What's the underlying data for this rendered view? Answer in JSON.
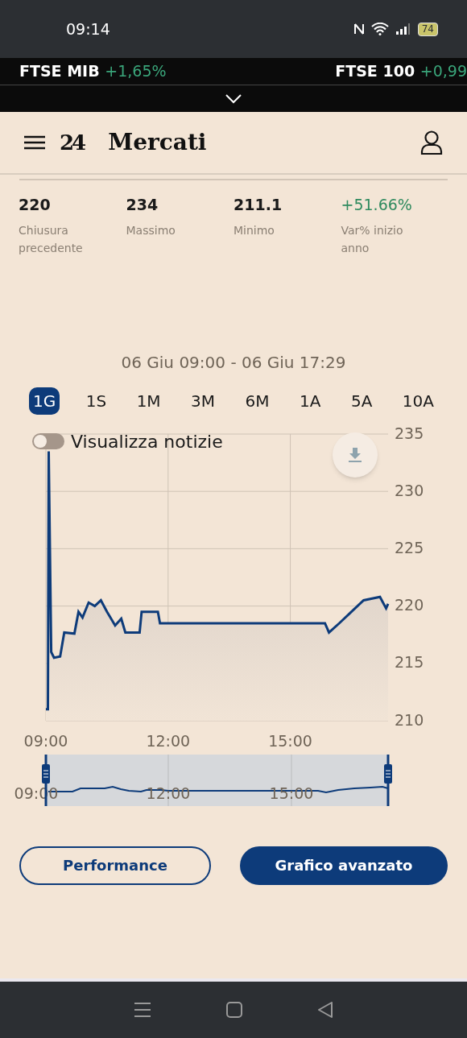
{
  "status_bar": {
    "time": "09:14",
    "battery": "74"
  },
  "ticker": [
    {
      "name": "FTSE MIB",
      "change": "+1,65%"
    },
    {
      "name": "FTSE 100",
      "change": "+0,99"
    }
  ],
  "header": {
    "logo": "24",
    "title": "Mercati"
  },
  "stats": [
    {
      "value": "220",
      "label": "Chiusura precedente",
      "positive": false
    },
    {
      "value": "234",
      "label": "Massimo",
      "positive": false
    },
    {
      "value": "211.1",
      "label": "Minimo",
      "positive": false
    },
    {
      "value": "+51.66%",
      "label": "Var% inizio anno",
      "positive": true
    }
  ],
  "date_range": "06 Giu 09:00 - 06 Giu 17:29",
  "periods": [
    {
      "label": "1G",
      "selected": true
    },
    {
      "label": "1S",
      "selected": false
    },
    {
      "label": "1M",
      "selected": false
    },
    {
      "label": "3M",
      "selected": false
    },
    {
      "label": "6M",
      "selected": false
    },
    {
      "label": "1A",
      "selected": false
    },
    {
      "label": "5A",
      "selected": false
    },
    {
      "label": "10A",
      "selected": false
    }
  ],
  "news_toggle": {
    "label": "Visualizza notizie",
    "on": false
  },
  "chart": {
    "chart_data": {
      "type": "area",
      "x": [
        9.0,
        9.05,
        9.07,
        9.13,
        9.2,
        9.35,
        9.45,
        9.7,
        9.8,
        9.9,
        10.05,
        10.2,
        10.35,
        10.5,
        10.7,
        10.85,
        10.95,
        11.3,
        11.35,
        11.75,
        11.8,
        15.85,
        15.95,
        16.2,
        16.5,
        16.8,
        17.2,
        17.35,
        17.4
      ],
      "grid": true,
      "series": [
        {
          "color": "#0d3b7a",
          "values": [
            211,
            211,
            233.5,
            216,
            215.5,
            215.6,
            217.7,
            217.6,
            219.5,
            219,
            220.3,
            220,
            220.5,
            219.5,
            218.3,
            218.9,
            217.7,
            217.7,
            219.5,
            219.5,
            218.5,
            218.5,
            217.7,
            218.5,
            219.5,
            220.5,
            220.8,
            219.8,
            220.2
          ]
        }
      ],
      "xlim": [
        9,
        17.4
      ],
      "ylim": [
        210,
        235
      ],
      "xticks": [
        {
          "value": 9,
          "label": "09:00"
        },
        {
          "value": 12,
          "label": "12:00"
        },
        {
          "value": 15,
          "label": "15:00"
        }
      ],
      "yticks": [
        210,
        215,
        220,
        225,
        230,
        235
      ]
    }
  },
  "navigator": {
    "labels": [
      "09:00",
      "12:00",
      "15:00"
    ]
  },
  "buttons": [
    {
      "label": "Performance",
      "kind": "outline"
    },
    {
      "label": "Grafico avanzato",
      "kind": "filled"
    }
  ]
}
